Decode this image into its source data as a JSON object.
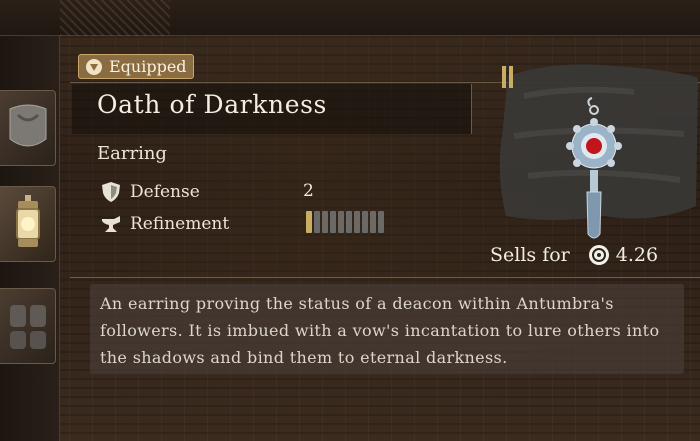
{
  "status": {
    "equipped_label": "Equipped"
  },
  "item": {
    "name": "Oath of Darkness",
    "type": "Earring",
    "stats": [
      {
        "label": "Defense",
        "value": "2",
        "icon": "shield-icon"
      },
      {
        "label": "Refinement",
        "icon": "anvil-icon",
        "refinement_level": 1,
        "refinement_max": 10
      }
    ],
    "sell": {
      "label": "Sells for",
      "value": "4.26",
      "icon": "coin-icon"
    },
    "description": "An earring proving the status of a deacon within Antumbra's followers. It is imbued with a vow's incantation to lure others into the shadows and bind them to eternal darkness."
  },
  "colors": {
    "accent_gold": "#c9ad63",
    "equipped_badge": "#8a6c43",
    "gem_red": "#c0151c"
  }
}
